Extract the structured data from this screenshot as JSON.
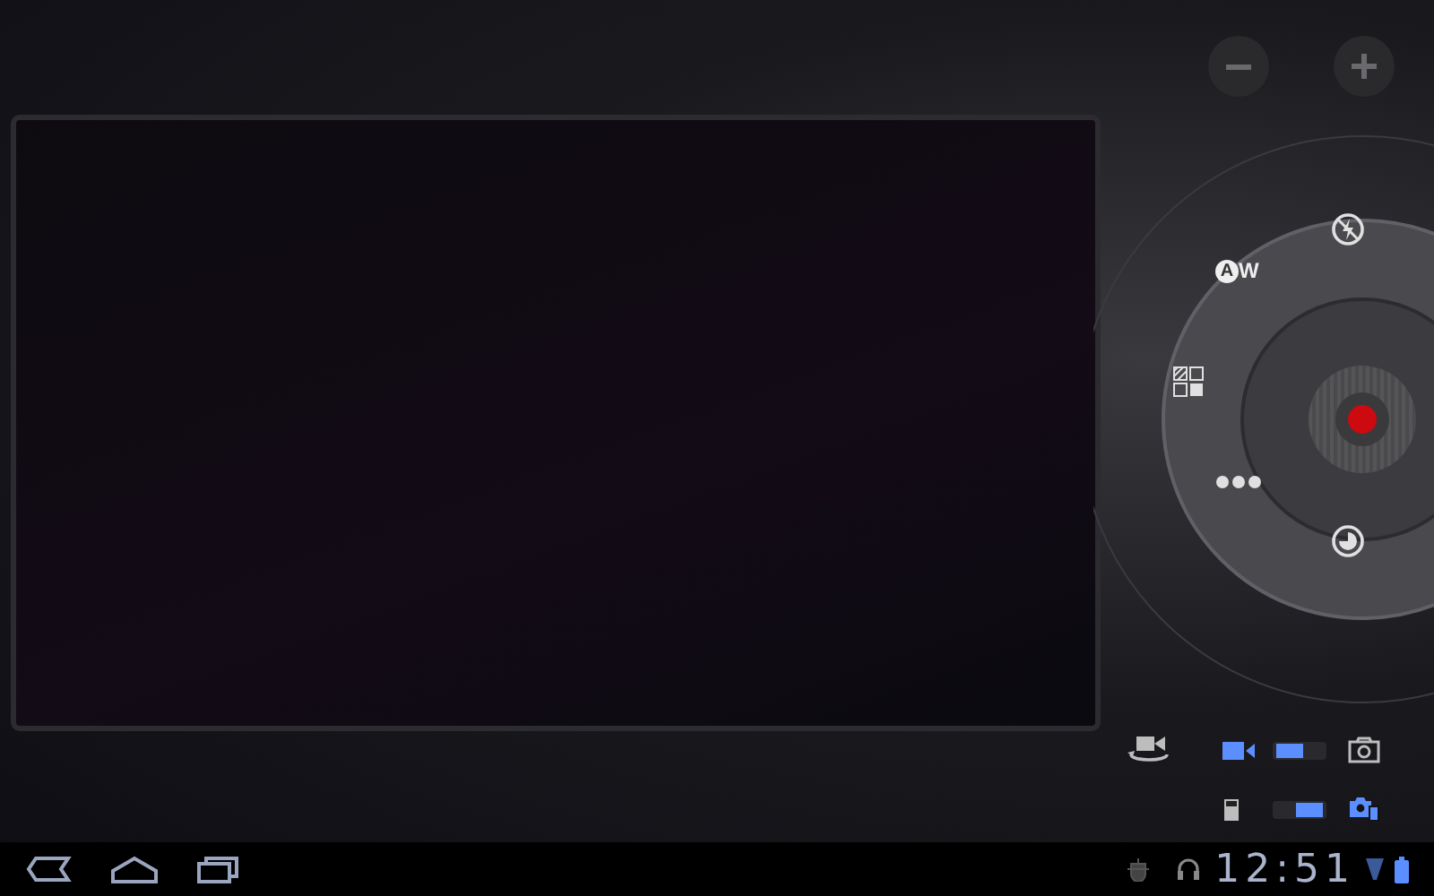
{
  "zoom": {
    "buttons": [
      {
        "kind": "minus"
      },
      {
        "kind": "plus"
      }
    ]
  },
  "wheel": {
    "items": [
      {
        "kind": "flash"
      },
      {
        "kind": "white_balance",
        "badge": "A",
        "label": "W"
      },
      {
        "kind": "effects"
      },
      {
        "kind": "more"
      },
      {
        "kind": "timer"
      }
    ],
    "shutter": {
      "recording": true
    }
  },
  "mode_switch": {
    "options": [
      {
        "kind": "video",
        "selected": true
      },
      {
        "kind": "camera",
        "selected": false
      }
    ]
  },
  "storage_switch": {
    "options": [
      {
        "kind": "card",
        "selected": false
      },
      {
        "kind": "camera_card",
        "selected": true
      }
    ]
  },
  "status_bar": {
    "nav": [
      {
        "kind": "back"
      },
      {
        "kind": "home"
      },
      {
        "kind": "recent"
      }
    ],
    "time": "12:51"
  }
}
